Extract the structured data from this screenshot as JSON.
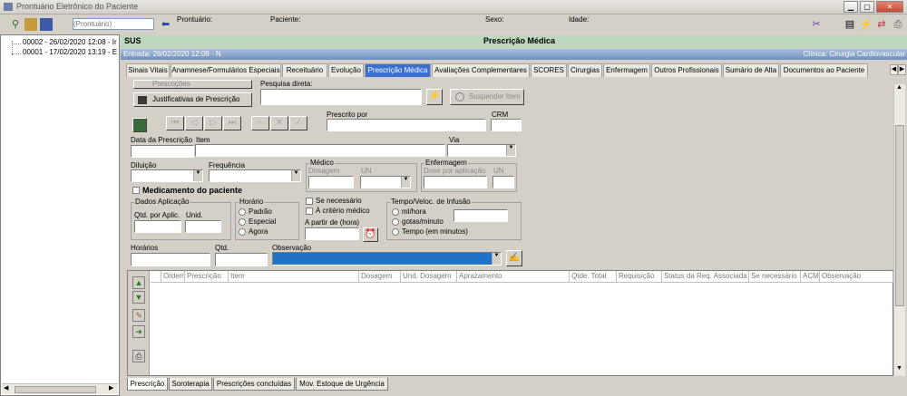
{
  "window": {
    "title": "Prontuário Eletrônico do Paciente",
    "min": "▁",
    "max": "▢",
    "close": "✕"
  },
  "toolbar": {
    "prontuario_placeholder": "(Prontuário)",
    "prontuario_label": "Prontuário:",
    "paciente_label": "Paciente:",
    "sexo_label": "Sexo:",
    "idade_label": "Idade:"
  },
  "tree": {
    "items": [
      "00002 - 26/02/2020 12:08 - Ir",
      "00001 - 17/02/2020 13:19 - E"
    ]
  },
  "header": {
    "sus": "SUS",
    "title": "Prescrição Médica",
    "entrada": "Entrada: 26/02/2020 12:08 - N",
    "clinica": "Clínica: Cirurgia Cardiovascular"
  },
  "tabs": [
    "Sinais Vitais",
    "Anamnese/Formulários Especiais",
    "Receituário",
    "Evolução",
    "Prescrição Médica",
    "Avaliações Complementares",
    "SCORES",
    "Cirurgias",
    "Enfermagem",
    "Outros Profissionais",
    "Sumário de Alta",
    "Documentos ao Paciente"
  ],
  "form": {
    "prescricoes_btn": "Prescrições",
    "justificativas_btn": "Justificativas de Prescrição",
    "pesquisa_label": "Pesquisa direta:",
    "suspender_btn": "Suspender Item",
    "prescrito_por": "Prescrito por",
    "crm": "CRM",
    "data_prescricao": "Data da Prescrição",
    "item": "Item",
    "via": "Via",
    "diluicao": "Diluição",
    "frequencia": "Frequência",
    "medico": "Médico",
    "dosagem": "Dosagem",
    "un": "UN",
    "enfermagem": "Enfermagem",
    "dose_por_aplicacao": "Dose por aplicação",
    "medicamento_paciente": "Medicamento do paciente",
    "dados_aplicacao": "Dados Aplicação",
    "qtd_por_aplic": "Qtd. por Aplic.",
    "unid": "Unid.",
    "horario": "Horário",
    "padrao": "Padrão",
    "especial": "Especial",
    "agora": "Agora",
    "se_necessario": "Se necessário",
    "a_criterio": "À critério médico",
    "a_partir": "A partir de (hora)",
    "tempo_infusao": "Tempo/Veloc. de Infusão",
    "ml_hora": "ml/hora",
    "gotas_minuto": "gotas/minuto",
    "tempo_minutos": "Tempo (em minutos)",
    "horarios": "Horários",
    "qtd": "Qtd.",
    "observacao": "Observação"
  },
  "grid": {
    "columns": [
      "Ordem",
      "Prescrição",
      "Item",
      "Dosagem",
      "Und. Dosagem",
      "Aprazamento",
      "Qtde. Total",
      "Requisição",
      "Status da Req. Associada",
      "Se necessário",
      "ACM",
      "Observação"
    ]
  },
  "bottom_tabs": [
    "Prescrição",
    "Soroterapia",
    "Prescrições concluídas",
    "Mov. Estoque de Urgência"
  ],
  "colors": {
    "accent": "#3a6fd1",
    "green_header": "#bcd8bc",
    "blue_header": "#6f8fbd"
  }
}
